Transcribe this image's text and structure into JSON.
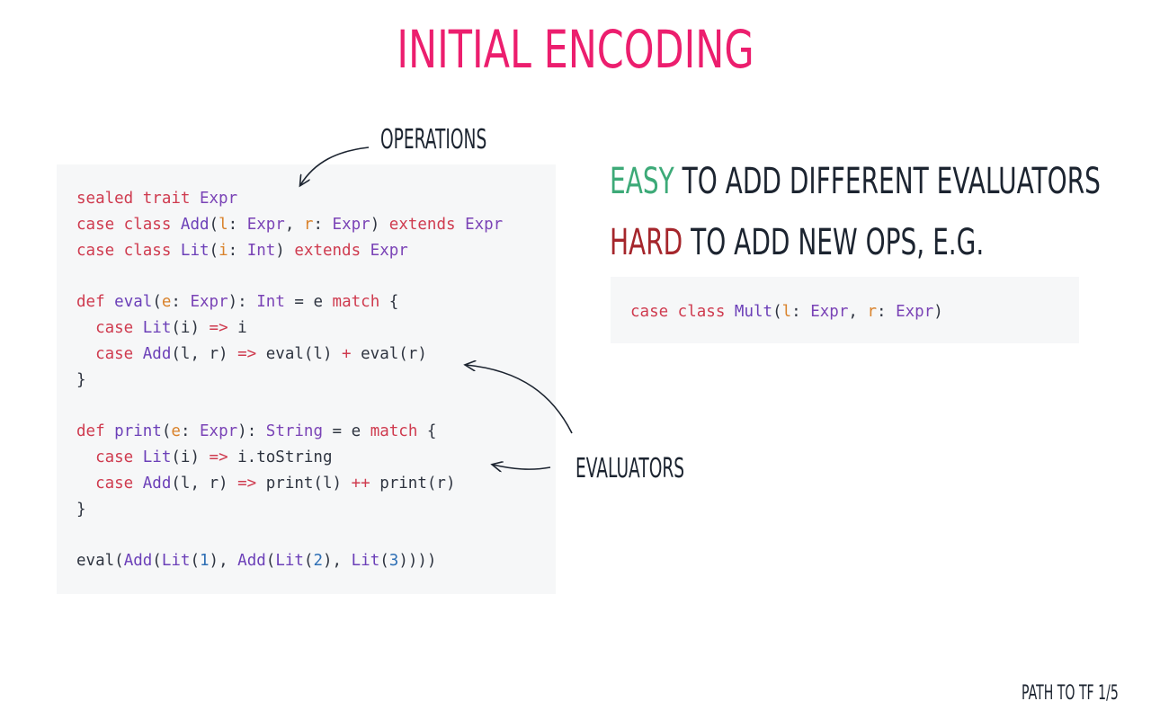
{
  "slide": {
    "title": "INITIAL ENCODING",
    "footer": "PATH TO TF 1/5"
  },
  "annotations": {
    "operations": "OPERATIONS",
    "evaluators": "EVALUATORS"
  },
  "headlines": {
    "easy_keyword": "EASY",
    "easy_rest": " TO ADD DIFFERENT EVALUATORS",
    "hard_keyword": "HARD",
    "hard_rest": " TO ADD NEW OPS, E.G."
  },
  "colors": {
    "title": "#ec1e6e",
    "easy": "#3daa78",
    "hard": "#a5262c",
    "code_background": "#f6f7f8",
    "text": "#1c2430"
  },
  "main_code": [
    [
      [
        "sealed trait ",
        "kw"
      ],
      [
        "Expr",
        "ty"
      ]
    ],
    [
      [
        "case class ",
        "kw"
      ],
      [
        "Add",
        "fn"
      ],
      [
        "(",
        "pl"
      ],
      [
        "l",
        "pr"
      ],
      [
        ": ",
        "pl"
      ],
      [
        "Expr",
        "ty"
      ],
      [
        ", ",
        "pl"
      ],
      [
        "r",
        "pr"
      ],
      [
        ": ",
        "pl"
      ],
      [
        "Expr",
        "ty"
      ],
      [
        ") ",
        "pl"
      ],
      [
        "extends ",
        "kw"
      ],
      [
        "Expr",
        "ty"
      ]
    ],
    [
      [
        "case class ",
        "kw"
      ],
      [
        "Lit",
        "fn"
      ],
      [
        "(",
        "pl"
      ],
      [
        "i",
        "pr"
      ],
      [
        ": ",
        "pl"
      ],
      [
        "Int",
        "ty"
      ],
      [
        ") ",
        "pl"
      ],
      [
        "extends ",
        "kw"
      ],
      [
        "Expr",
        "ty"
      ]
    ],
    [],
    [
      [
        "def ",
        "kw"
      ],
      [
        "eval",
        "fn"
      ],
      [
        "(",
        "pl"
      ],
      [
        "e",
        "pr"
      ],
      [
        ": ",
        "pl"
      ],
      [
        "Expr",
        "ty"
      ],
      [
        "): ",
        "pl"
      ],
      [
        "Int",
        "ty"
      ],
      [
        " = e ",
        "pl"
      ],
      [
        "match",
        "kw"
      ],
      [
        " {",
        "pl"
      ]
    ],
    [
      [
        "  case ",
        "kw"
      ],
      [
        "Lit",
        "fn"
      ],
      [
        "(i) ",
        "pl"
      ],
      [
        "=>",
        "op"
      ],
      [
        " i",
        "pl"
      ]
    ],
    [
      [
        "  case ",
        "kw"
      ],
      [
        "Add",
        "fn"
      ],
      [
        "(l, r) ",
        "pl"
      ],
      [
        "=>",
        "op"
      ],
      [
        " eval(l) ",
        "pl"
      ],
      [
        "+",
        "op"
      ],
      [
        " eval(r)",
        "pl"
      ]
    ],
    [
      [
        "}",
        "pl"
      ]
    ],
    [],
    [
      [
        "def ",
        "kw"
      ],
      [
        "print",
        "fn"
      ],
      [
        "(",
        "pl"
      ],
      [
        "e",
        "pr"
      ],
      [
        ": ",
        "pl"
      ],
      [
        "Expr",
        "ty"
      ],
      [
        "): ",
        "pl"
      ],
      [
        "String",
        "ty"
      ],
      [
        " = e ",
        "pl"
      ],
      [
        "match",
        "kw"
      ],
      [
        " {",
        "pl"
      ]
    ],
    [
      [
        "  case ",
        "kw"
      ],
      [
        "Lit",
        "fn"
      ],
      [
        "(i) ",
        "pl"
      ],
      [
        "=>",
        "op"
      ],
      [
        " i.toString",
        "pl"
      ]
    ],
    [
      [
        "  case ",
        "kw"
      ],
      [
        "Add",
        "fn"
      ],
      [
        "(l, r) ",
        "pl"
      ],
      [
        "=>",
        "op"
      ],
      [
        " print(l) ",
        "pl"
      ],
      [
        "++",
        "op"
      ],
      [
        " print(r)",
        "pl"
      ]
    ],
    [
      [
        "}",
        "pl"
      ]
    ],
    [],
    [
      [
        "eval(",
        "pl"
      ],
      [
        "Add",
        "fn"
      ],
      [
        "(",
        "pl"
      ],
      [
        "Lit",
        "fn"
      ],
      [
        "(",
        "pl"
      ],
      [
        "1",
        "nu"
      ],
      [
        "), ",
        "pl"
      ],
      [
        "Add",
        "fn"
      ],
      [
        "(",
        "pl"
      ],
      [
        "Lit",
        "fn"
      ],
      [
        "(",
        "pl"
      ],
      [
        "2",
        "nu"
      ],
      [
        "), ",
        "pl"
      ],
      [
        "Lit",
        "fn"
      ],
      [
        "(",
        "pl"
      ],
      [
        "3",
        "nu"
      ],
      [
        "))))",
        "pl"
      ]
    ]
  ],
  "side_code": [
    [
      [
        "case class ",
        "kw"
      ],
      [
        "Mult",
        "fn"
      ],
      [
        "(",
        "pl"
      ],
      [
        "l",
        "pr"
      ],
      [
        ": ",
        "pl"
      ],
      [
        "Expr",
        "ty"
      ],
      [
        ", ",
        "pl"
      ],
      [
        "r",
        "pr"
      ],
      [
        ": ",
        "pl"
      ],
      [
        "Expr",
        "ty"
      ],
      [
        ")",
        "pl"
      ]
    ]
  ]
}
